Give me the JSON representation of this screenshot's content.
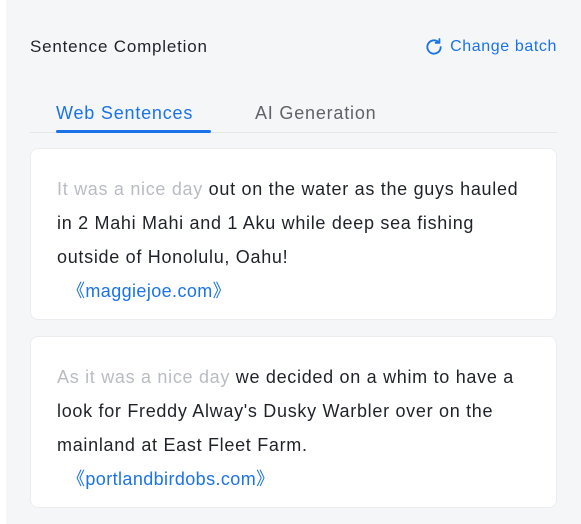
{
  "header": {
    "title": "Sentence Completion",
    "change_batch_label": "Change batch",
    "change_batch_icon": "refresh-icon"
  },
  "tabs": [
    {
      "label": "Web Sentences",
      "active": true
    },
    {
      "label": "AI Generation",
      "active": false
    }
  ],
  "cards": [
    {
      "prefix": "It was a nice day",
      "completion": " out on the water as the guys hauled in 2 Mahi Mahi and 1 Aku while deep sea fishing outside of Honolulu, Oahu!",
      "source": "《maggiejoe.com》"
    },
    {
      "prefix": "As it was a nice day",
      "completion": " we decided on a whim to have a look for Freddy Alway's Dusky Warbler over on the mainland at East Fleet Farm.",
      "source": "《portlandbirdobs.com》"
    }
  ],
  "colors": {
    "accent": "#1a73e8",
    "panel_bg": "#f5f6f8",
    "prefix_text": "#b9bcc2",
    "body_text": "#1f2329"
  }
}
